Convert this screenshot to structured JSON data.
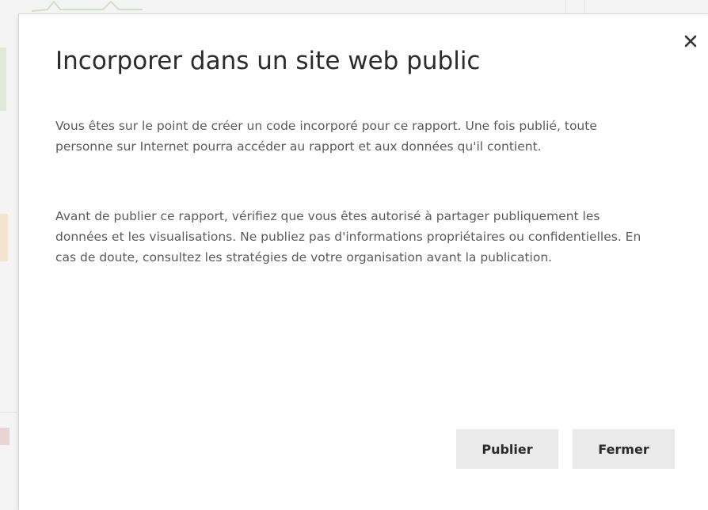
{
  "dialog": {
    "title": "Incorporer dans un site web public",
    "paragraph_1": "Vous êtes sur le point de créer un code incorporé pour ce rapport. Une fois publié, toute personne sur Internet pourra accéder au rapport et aux données qu'il contient.",
    "paragraph_2": "Avant de publier ce rapport, vérifiez que vous êtes autorisé à partager publiquement les données et les visualisations. Ne publiez pas d'informations propriétaires ou confidentielles. En cas de doute, consultez les stratégies de votre organisation avant la publication.",
    "close_icon": "close-icon",
    "buttons": {
      "publish_label": "Publier",
      "close_label": "Fermer"
    }
  },
  "colors": {
    "title_text": "#2b2b2b",
    "body_text": "#5a5a5a",
    "button_bg": "#eaeaea",
    "dialog_bg": "#ffffff"
  }
}
